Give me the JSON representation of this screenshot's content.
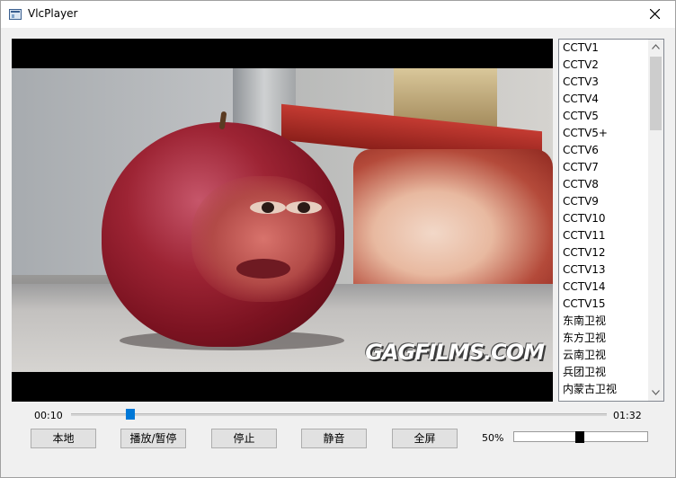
{
  "window": {
    "title": "VlcPlayer"
  },
  "video": {
    "watermark": "GAGFILMS.COM"
  },
  "channels": [
    "CCTV1",
    "CCTV2",
    "CCTV3",
    "CCTV4",
    "CCTV5",
    "CCTV5+",
    "CCTV6",
    "CCTV7",
    "CCTV8",
    "CCTV9",
    "CCTV10",
    "CCTV11",
    "CCTV12",
    "CCTV13",
    "CCTV14",
    "CCTV15",
    "东南卫视",
    "东方卫视",
    "云南卫视",
    "兵团卫视",
    "内蒙古卫视"
  ],
  "playback": {
    "current_time": "00:10",
    "total_time": "01:32",
    "progress": 0.11
  },
  "controls": {
    "local_label": "本地",
    "play_pause_label": "播放/暂停",
    "stop_label": "停止",
    "mute_label": "静音",
    "fullscreen_label": "全屏"
  },
  "volume": {
    "label": "50%",
    "level": 0.5
  },
  "colors": {
    "accent": "#0078d7"
  },
  "icons": {
    "close": "close-icon",
    "app": "app-icon"
  }
}
